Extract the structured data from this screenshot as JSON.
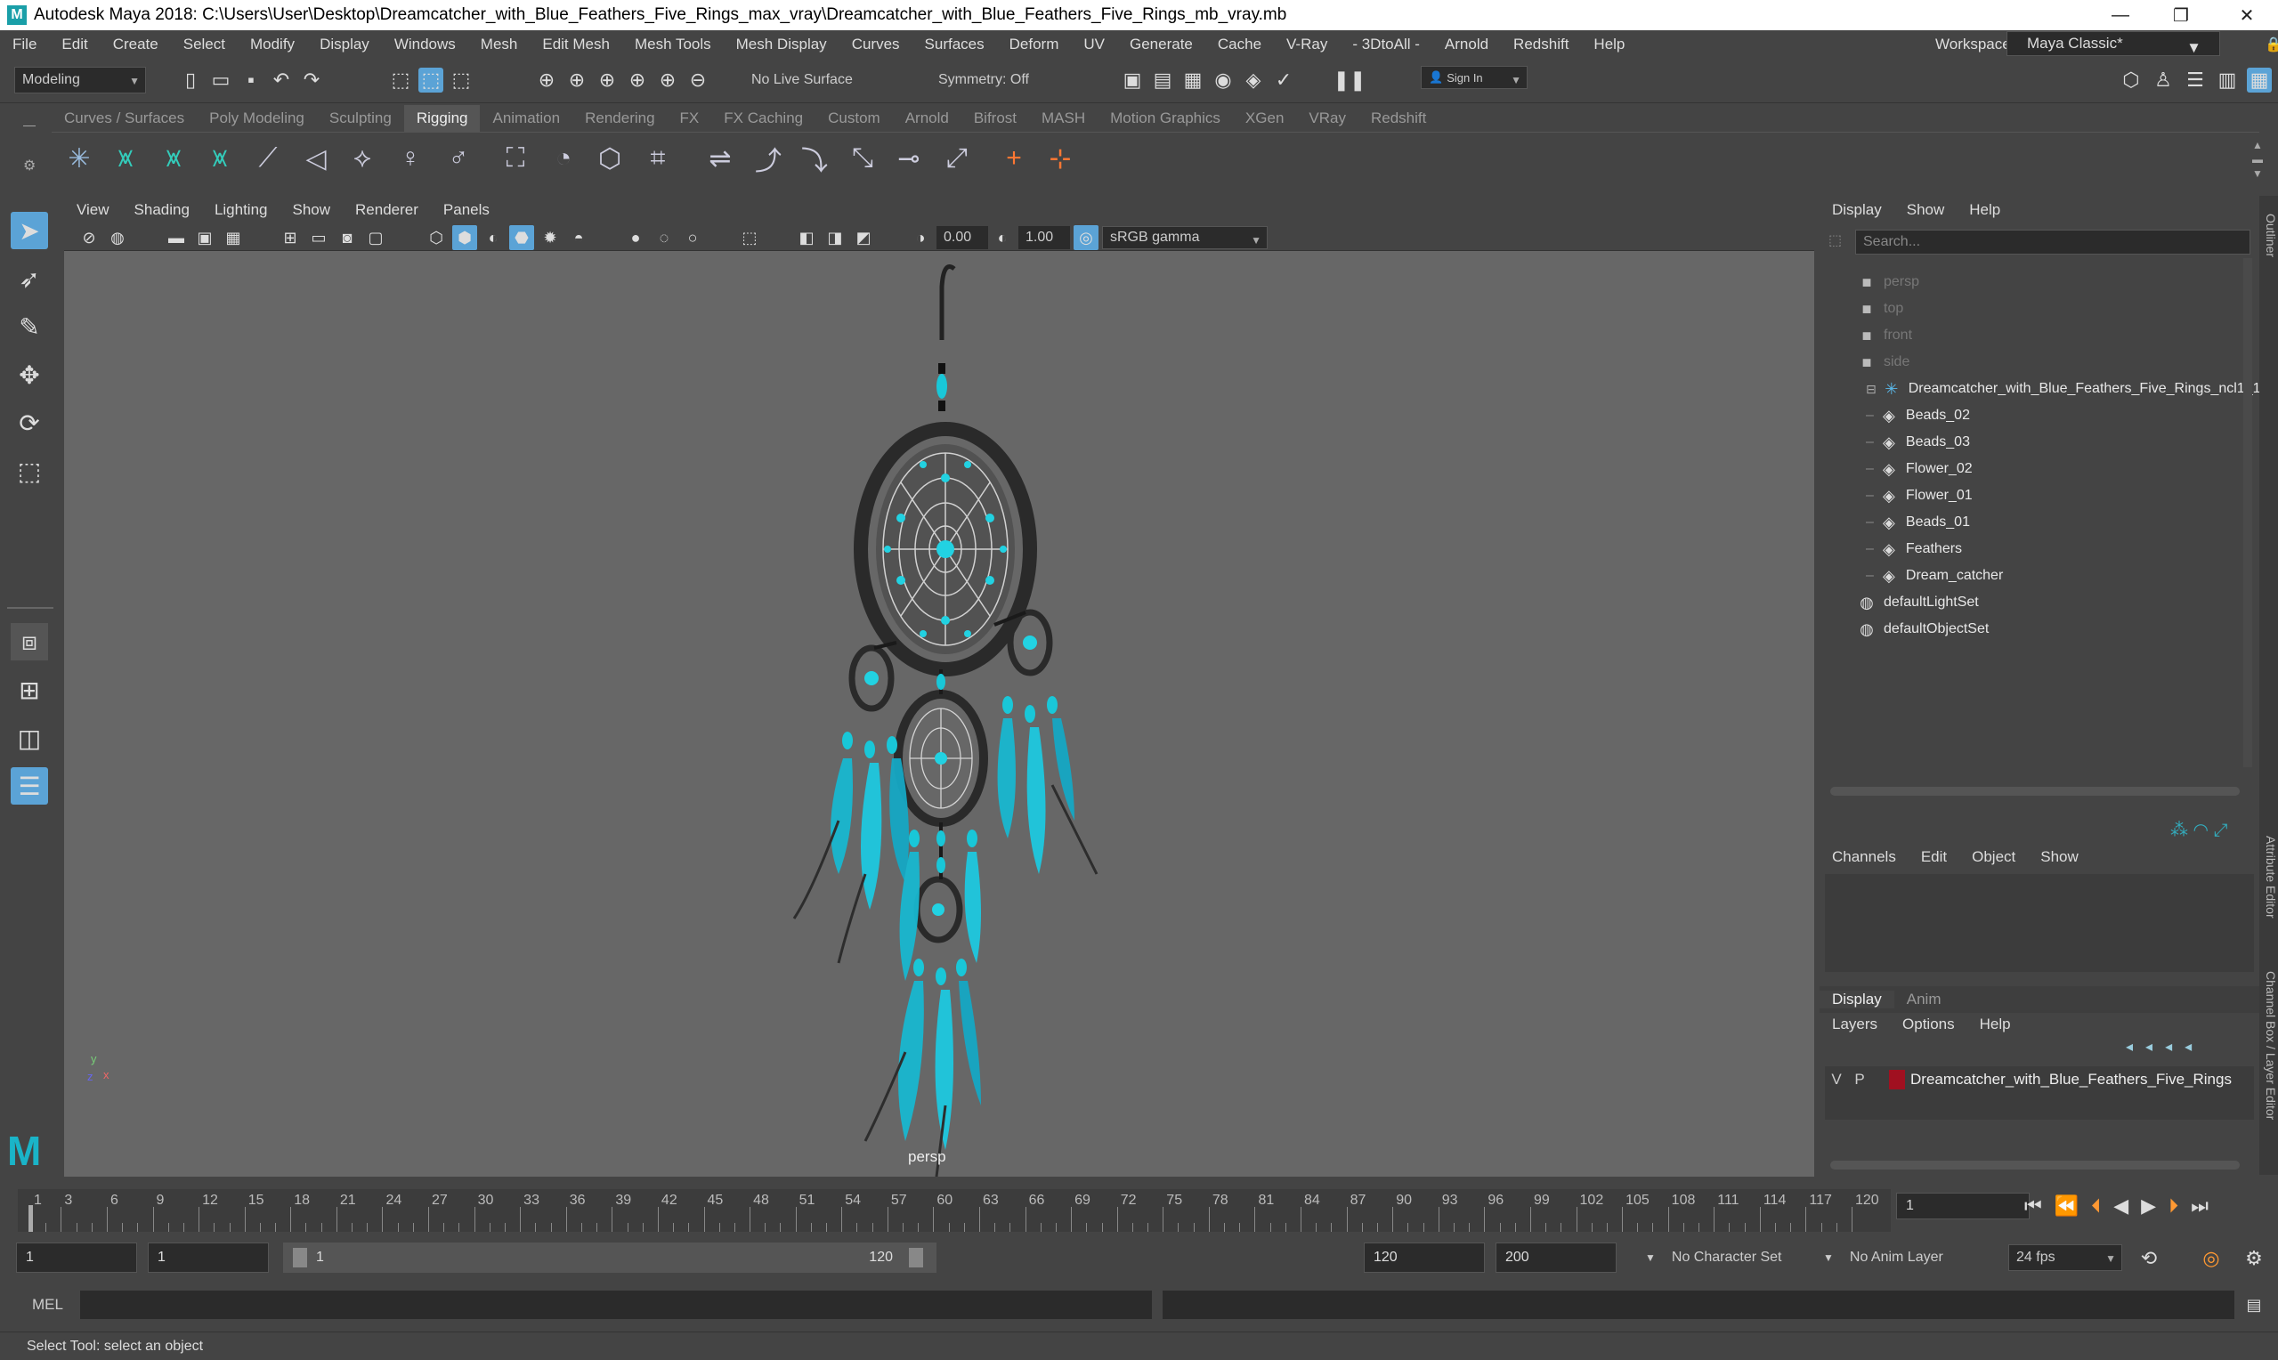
{
  "title_bar": {
    "text": "Autodesk Maya 2018: C:\\Users\\User\\Desktop\\Dreamcatcher_with_Blue_Feathers_Five_Rings_max_vray\\Dreamcatcher_with_Blue_Feathers_Five_Rings_mb_vray.mb",
    "minimize": "—",
    "maximize": "❐",
    "close": "✕"
  },
  "menu": [
    "File",
    "Edit",
    "Create",
    "Select",
    "Modify",
    "Display",
    "Windows",
    "Mesh",
    "Edit Mesh",
    "Mesh Tools",
    "Mesh Display",
    "Curves",
    "Surfaces",
    "Deform",
    "UV",
    "Generate",
    "Cache",
    "V-Ray",
    "- 3DtoAll -",
    "Arnold",
    "Redshift",
    "Help"
  ],
  "workspace": {
    "label": "Workspace :",
    "value": "Maya Classic*"
  },
  "toolbar": {
    "mode": "Modeling",
    "live_surface": "No Live Surface",
    "symmetry": "Symmetry: Off",
    "sign_in": "Sign In"
  },
  "shelf_tabs": [
    "Curves / Surfaces",
    "Poly Modeling",
    "Sculpting",
    "Rigging",
    "Animation",
    "Rendering",
    "FX",
    "FX Caching",
    "Custom",
    "Arnold",
    "Bifrost",
    "MASH",
    "Motion Graphics",
    "XGen",
    "VRay",
    "Redshift"
  ],
  "shelf_active": "Rigging",
  "viewport": {
    "menu": [
      "View",
      "Shading",
      "Lighting",
      "Show",
      "Renderer",
      "Panels"
    ],
    "exposure": "0.00",
    "gamma": "1.00",
    "color_space": "sRGB gamma",
    "camera_label": "persp"
  },
  "outliner": {
    "menu": [
      "Display",
      "Show",
      "Help"
    ],
    "search_placeholder": "Search...",
    "items": [
      {
        "label": "persp",
        "icon": "camera-icon",
        "dim": true,
        "indent": 1
      },
      {
        "label": "top",
        "icon": "camera-icon",
        "dim": true,
        "indent": 1
      },
      {
        "label": "front",
        "icon": "camera-icon",
        "dim": true,
        "indent": 1
      },
      {
        "label": "side",
        "icon": "camera-icon",
        "dim": true,
        "indent": 1
      },
      {
        "label": "Dreamcatcher_with_Blue_Feathers_Five_Rings_ncl1_1",
        "icon": "group-icon",
        "dim": false,
        "indent": 0
      },
      {
        "label": "Beads_02",
        "icon": "mesh-icon",
        "dim": false,
        "indent": 2
      },
      {
        "label": "Beads_03",
        "icon": "mesh-icon",
        "dim": false,
        "indent": 2
      },
      {
        "label": "Flower_02",
        "icon": "mesh-icon",
        "dim": false,
        "indent": 2
      },
      {
        "label": "Flower_01",
        "icon": "mesh-icon",
        "dim": false,
        "indent": 2
      },
      {
        "label": "Beads_01",
        "icon": "mesh-icon",
        "dim": false,
        "indent": 2
      },
      {
        "label": "Feathers",
        "icon": "mesh-icon",
        "dim": false,
        "indent": 2
      },
      {
        "label": "Dream_catcher",
        "icon": "mesh-icon",
        "dim": false,
        "indent": 2
      },
      {
        "label": "defaultLightSet",
        "icon": "set-icon",
        "dim": false,
        "indent": 1
      },
      {
        "label": "defaultObjectSet",
        "icon": "set-icon",
        "dim": false,
        "indent": 1
      }
    ]
  },
  "channel_box": {
    "menu": [
      "Channels",
      "Edit",
      "Object",
      "Show"
    ]
  },
  "layer_editor": {
    "tabs": [
      "Display",
      "Anim"
    ],
    "menu": [
      "Layers",
      "Options",
      "Help"
    ],
    "layer": {
      "v": "V",
      "p": "P",
      "name": "Dreamcatcher_with_Blue_Feathers_Five_Rings",
      "color": "#a01020"
    }
  },
  "side_tabs": [
    "Outliner",
    "Attribute Editor",
    "Channel Box / Layer Editor"
  ],
  "timeline": {
    "ticks": [
      "1",
      "3",
      "6",
      "9",
      "12",
      "15",
      "18",
      "21",
      "24",
      "27",
      "30",
      "33",
      "36",
      "39",
      "42",
      "45",
      "48",
      "51",
      "54",
      "57",
      "60",
      "63",
      "66",
      "69",
      "72",
      "75",
      "78",
      "81",
      "84",
      "87",
      "90",
      "93",
      "96",
      "99",
      "102",
      "105",
      "108",
      "111",
      "114",
      "117",
      "120"
    ],
    "current_frame": "1"
  },
  "range": {
    "start": "1",
    "inner_start": "1",
    "slider_start": "1",
    "slider_end": "120",
    "end": "120",
    "outer_end": "200",
    "char_set": "No Character Set",
    "anim_layer": "No Anim Layer",
    "fps": "24 fps"
  },
  "command_line": {
    "label": "MEL"
  },
  "status_line": "Select Tool: select an object",
  "colors": {
    "accent": "#5ba3d6",
    "teal": "#21c6d8",
    "bg": "#444444",
    "viewport": "#676767"
  }
}
